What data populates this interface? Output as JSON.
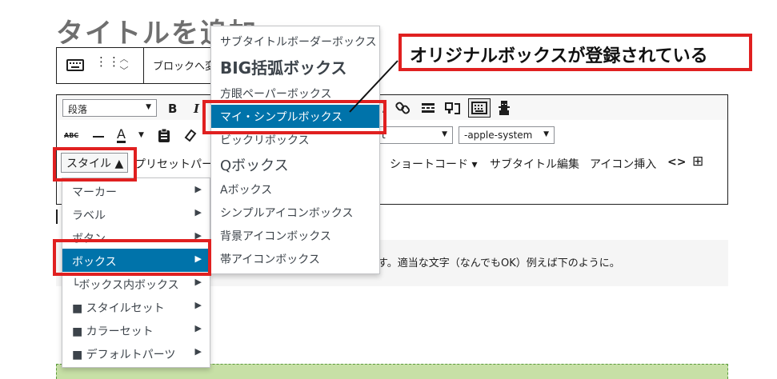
{
  "page": {
    "title": "タイトルを追加"
  },
  "block_toolbar": {
    "label": "ブロックへ変"
  },
  "editor_toolbar": {
    "format_select": "段落",
    "bold": "B",
    "italic": "I",
    "strike": "ABC",
    "text_color": "A",
    "font_size_select": "t",
    "font_family_select": "-apple-system",
    "style_button": "スタイル ▲",
    "preset_button": "プリセットパー",
    "shortcode": "ショートコード ▾",
    "subtitle_edit": "サブタイトル編集",
    "icon_insert": "アイコン挿入",
    "code_icon": "<>",
    "table_icon": "⊞"
  },
  "style_menu": {
    "items": [
      {
        "label": "マーカー"
      },
      {
        "label": "ラベル"
      },
      {
        "label": "ボタン"
      },
      {
        "label": "ボックス"
      },
      {
        "label": "└ボックス内ボックス"
      },
      {
        "label": "■ スタイルセット"
      },
      {
        "label": "■ カラーセット"
      },
      {
        "label": "■ デフォルトパーツ"
      }
    ]
  },
  "box_submenu": {
    "items": [
      {
        "label": "サブタイトルボーダーボックス"
      },
      {
        "label": "BIG括弧ボックス"
      },
      {
        "label": "方眼ペーパーボックス"
      },
      {
        "label": "マイ・シンプルボックス"
      },
      {
        "label": "ビックリボックス"
      },
      {
        "label": "Qボックス"
      },
      {
        "label": "Aボックス"
      },
      {
        "label": "シンプルアイコンボックス"
      },
      {
        "label": "背景アイコンボックス"
      },
      {
        "label": "帯アイコンボックス"
      }
    ]
  },
  "annotation": {
    "text": "オリジナルボックスが登録されている"
  },
  "content": {
    "text": "す。適当な文字（なんでもOK）例えば下のように。"
  },
  "colors": {
    "accent": "#0073aa",
    "highlight": "#e02020",
    "green_block": "#c7e0a6"
  }
}
